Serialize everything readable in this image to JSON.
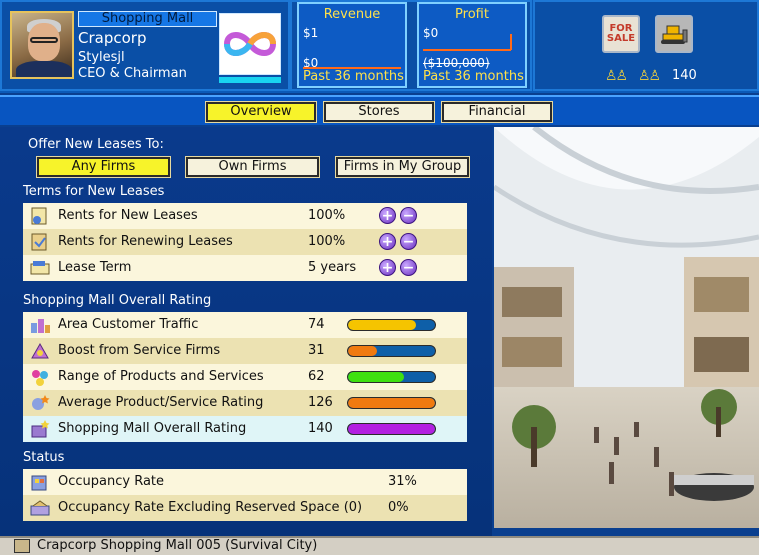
{
  "header": {
    "company_type": "Shopping Mall",
    "company_name": "Crapcorp",
    "ceo_name": "Stylesjl",
    "ceo_title": "CEO & Chairman",
    "revenue": {
      "title": "Revenue",
      "top_label": "$1",
      "bottom_label": "$0",
      "footer": "Past 36 months"
    },
    "profit": {
      "title": "Profit",
      "top_label": "$0",
      "bottom_label": "($100,000)",
      "footer": "Past 36 months"
    },
    "for_sale_label": "FOR SALE",
    "employees_count": "140"
  },
  "tabs": [
    {
      "label": "Overview",
      "active": true
    },
    {
      "label": "Stores",
      "active": false
    },
    {
      "label": "Financial",
      "active": false
    }
  ],
  "offer": {
    "heading": "Offer New Leases To:",
    "options": [
      {
        "label": "Any Firms",
        "active": true
      },
      {
        "label": "Own Firms",
        "active": false
      },
      {
        "label": "Firms in My Group",
        "active": false
      }
    ]
  },
  "terms": {
    "heading": "Terms for New Leases",
    "rows": [
      {
        "label": "Rents for New Leases",
        "value": "100%"
      },
      {
        "label": "Rents for Renewing Leases",
        "value": "100%"
      },
      {
        "label": "Lease Term",
        "value": "5  years"
      }
    ]
  },
  "rating": {
    "heading": "Shopping Mall Overall Rating",
    "rows": [
      {
        "label": "Area Customer Traffic",
        "value": "74",
        "level": 0.78,
        "color": "#f5c400"
      },
      {
        "label": "Boost from Service Firms",
        "value": "31",
        "level": 0.33,
        "color": "#f07a10"
      },
      {
        "label": "Range of Products and Services",
        "value": "62",
        "level": 0.64,
        "color": "#3fe010"
      },
      {
        "label": "Average Product/Service Rating",
        "value": "126",
        "level": 1.0,
        "color": "#f07a10"
      },
      {
        "label": "Shopping Mall Overall Rating",
        "value": "140",
        "level": 1.0,
        "color": "#b320e0"
      }
    ]
  },
  "status": {
    "heading": "Status",
    "rows": [
      {
        "label": "Occupancy Rate",
        "value": "31%"
      },
      {
        "label": "Occupancy Rate Excluding Reserved Space (0)",
        "value": "0%"
      }
    ]
  },
  "statusbar": {
    "text": "Crapcorp Shopping Mall 005 (Survival City)"
  }
}
